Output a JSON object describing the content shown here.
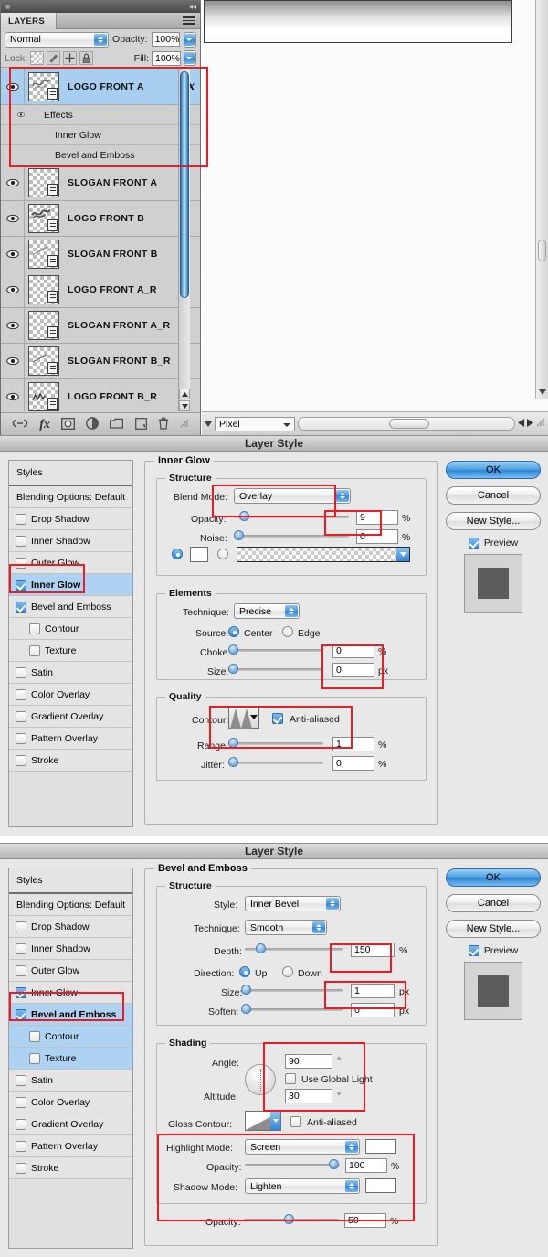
{
  "layers_panel": {
    "tab_label": "LAYERS",
    "blend_mode": "Normal",
    "opacity_label": "Opacity:",
    "opacity_value": "100%",
    "lock_label": "Lock:",
    "fill_label": "Fill:",
    "fill_value": "100%",
    "layers": [
      {
        "name": "LOGO FRONT A",
        "selected": true,
        "has_fx": true,
        "effects_label": "Effects",
        "effects": [
          "Inner Glow",
          "Bevel and Emboss"
        ]
      },
      {
        "name": "SLOGAN FRONT A",
        "selected": false,
        "has_fx": false
      },
      {
        "name": "LOGO FRONT B",
        "selected": false,
        "has_fx": false
      },
      {
        "name": "SLOGAN FRONT B",
        "selected": false,
        "has_fx": false
      },
      {
        "name": "LOGO FRONT A_R",
        "selected": false,
        "has_fx": false
      },
      {
        "name": "SLOGAN FRONT A_R",
        "selected": false,
        "has_fx": false
      },
      {
        "name": "SLOGAN FRONT B_R",
        "selected": false,
        "has_fx": false
      },
      {
        "name": "LOGO FRONT B_R",
        "selected": false,
        "has_fx": false
      }
    ],
    "bottom_icons": [
      "link-icon",
      "fx-icon",
      "mask-icon",
      "adjustment-icon",
      "folder-icon",
      "new-layer-icon",
      "trash-icon"
    ]
  },
  "statusbar": {
    "unit_value": "Pixel"
  },
  "styles_list": {
    "header": "Styles",
    "blending_options": "Blending Options: Default",
    "items": [
      {
        "label": "Drop Shadow",
        "checked": false,
        "indent": false
      },
      {
        "label": "Inner Shadow",
        "checked": false,
        "indent": false
      },
      {
        "label": "Outer Glow",
        "checked": false,
        "indent": false
      },
      {
        "label": "Inner Glow",
        "checked": true,
        "indent": false
      },
      {
        "label": "Bevel and Emboss",
        "checked": true,
        "indent": false
      },
      {
        "label": "Contour",
        "checked": false,
        "indent": true
      },
      {
        "label": "Texture",
        "checked": false,
        "indent": true
      },
      {
        "label": "Satin",
        "checked": false,
        "indent": false
      },
      {
        "label": "Color Overlay",
        "checked": false,
        "indent": false
      },
      {
        "label": "Gradient Overlay",
        "checked": false,
        "indent": false
      },
      {
        "label": "Pattern Overlay",
        "checked": false,
        "indent": false
      },
      {
        "label": "Stroke",
        "checked": false,
        "indent": false
      }
    ]
  },
  "buttons": {
    "ok": "OK",
    "cancel": "Cancel",
    "new_style": "New Style...",
    "preview": "Preview"
  },
  "dialog1": {
    "title": "Layer Style",
    "section_title": "Inner Glow",
    "structure": {
      "title": "Structure",
      "blend_mode_label": "Blend Mode:",
      "blend_mode_value": "Overlay",
      "opacity_label": "Opacity:",
      "opacity_value": "9",
      "opacity_unit": "%",
      "noise_label": "Noise:",
      "noise_value": "0",
      "noise_unit": "%"
    },
    "elements": {
      "title": "Elements",
      "technique_label": "Technique:",
      "technique_value": "Precise",
      "source_label": "Source:",
      "source_center": "Center",
      "source_edge": "Edge",
      "choke_label": "Choke:",
      "choke_value": "0",
      "choke_unit": "%",
      "size_label": "Size:",
      "size_value": "0",
      "size_unit": "px"
    },
    "quality": {
      "title": "Quality",
      "contour_label": "Contour:",
      "anti_aliased": "Anti-aliased",
      "range_label": "Range:",
      "range_value": "1",
      "range_unit": "%",
      "jitter_label": "Jitter:",
      "jitter_value": "0",
      "jitter_unit": "%"
    }
  },
  "dialog2": {
    "title": "Layer Style",
    "section_title": "Bevel and Emboss",
    "structure": {
      "title": "Structure",
      "style_label": "Style:",
      "style_value": "Inner Bevel",
      "technique_label": "Technique:",
      "technique_value": "Smooth",
      "depth_label": "Depth:",
      "depth_value": "150",
      "depth_unit": "%",
      "direction_label": "Direction:",
      "direction_up": "Up",
      "direction_down": "Down",
      "size_label": "Size:",
      "size_value": "1",
      "size_unit": "px",
      "soften_label": "Soften:",
      "soften_value": "0",
      "soften_unit": "px"
    },
    "shading": {
      "title": "Shading",
      "angle_label": "Angle:",
      "angle_value": "90",
      "angle_unit": "°",
      "use_global_light": "Use Global Light",
      "altitude_label": "Altitude:",
      "altitude_value": "30",
      "altitude_unit": "°",
      "gloss_contour_label": "Gloss Contour:",
      "anti_aliased": "Anti-aliased",
      "highlight_mode_label": "Highlight Mode:",
      "highlight_mode_value": "Screen",
      "highlight_opacity_label": "Opacity:",
      "highlight_opacity_value": "100",
      "highlight_opacity_unit": "%",
      "shadow_mode_label": "Shadow Mode:",
      "shadow_mode_value": "Lighten",
      "shadow_opacity_label": "Opacity:",
      "shadow_opacity_value": "50",
      "shadow_opacity_unit": "%"
    }
  },
  "colors": {
    "highlight_red": "#ec1c24",
    "selection_blue": "#a8cef0",
    "aqua_blue": "#2f86d6"
  }
}
